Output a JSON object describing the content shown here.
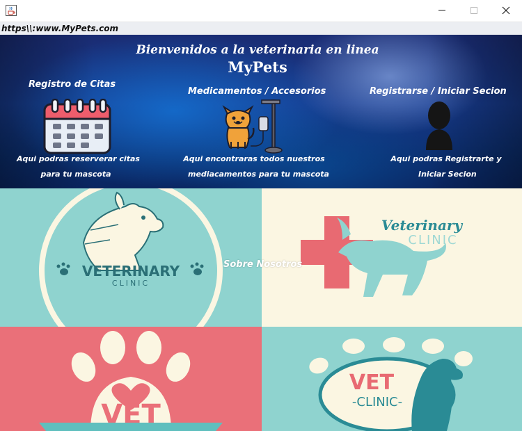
{
  "window": {
    "app_icon": "java-coffee-icon",
    "controls": [
      "minimize-icon",
      "maximize-icon",
      "close-icon"
    ]
  },
  "url": "https\\\\:www.MyPets.com",
  "banner": {
    "welcome": "Bienvenidos a la veterinaria en linea",
    "brand": "MyPets",
    "sections": [
      {
        "title": "Registro de Citas",
        "icon": "calendar-icon",
        "desc_line1": "Aqui podras reserverar citas",
        "desc_line2": "para tu mascota"
      },
      {
        "title": "Medicamentos / Accesorios",
        "icon": "dog-iv-drip-icon",
        "desc_line1": "Aqui encontraras todos nuestros",
        "desc_line2": "mediacamentos para tu mascota"
      },
      {
        "title": "Registrarse / Iniciar Secion",
        "icon": "user-silhouette-icon",
        "desc_line1": "Aqui podras Registrarte y",
        "desc_line2": "Iniciar Secion"
      }
    ]
  },
  "gallery": {
    "about": "Sobre Nosotros",
    "tile1": {
      "main": "VETERINARY",
      "sub": "CLINIC"
    },
    "tile2": {
      "main": "Veterinary",
      "sub": "CLINIC"
    },
    "tile3": {
      "main": "VET"
    },
    "tile4": {
      "main": "VET",
      "sub": "-CLINIC-"
    }
  },
  "colors": {
    "teal": "#8fd3cf",
    "cream": "#fbf6e2",
    "coral": "#ea7079",
    "cross": "#e86a72",
    "dark_teal": "#2a8b95"
  }
}
